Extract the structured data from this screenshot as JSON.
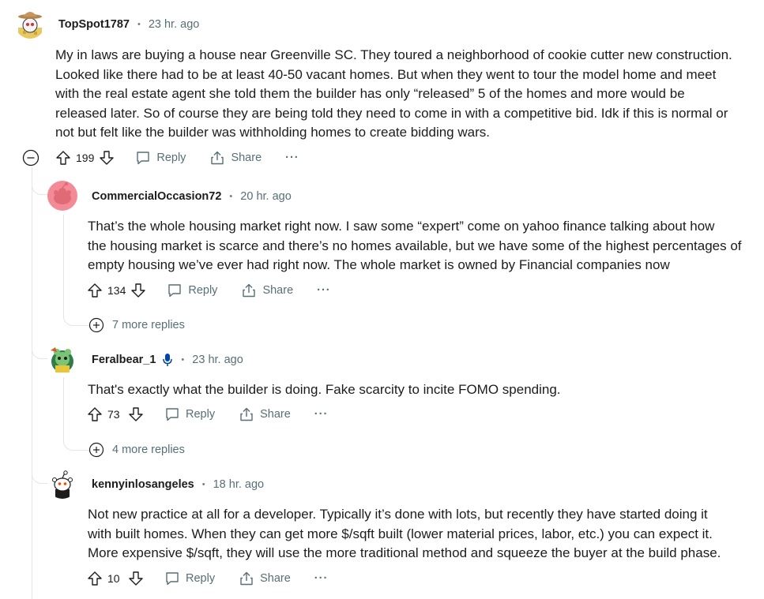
{
  "comments": [
    {
      "username": "TopSpot1787",
      "time": "23 hr. ago",
      "body": [
        "My in laws are buying a house near Greenville SC. They toured a neighborhood of cookie cutter new construction.",
        "Looked like there had to be at least 40-50 vacant homes. But when they went to tour the model home and meet",
        "with the real estate agent she told them the builder has only “released” 5 of the homes and more would be",
        "released later. So of course they are being told they need to come in with a competitive bid. Idk if this is normal or",
        "not but felt like the builder was withholding homes to create bidding wars."
      ],
      "votes": "199",
      "reply_label": "Reply",
      "share_label": "Share",
      "more_label": "···"
    },
    {
      "username": "CommercialOccasion72",
      "time": "20 hr. ago",
      "body": [
        "That’s the whole housing market right now. I saw some “expert” come on yahoo finance talking about how",
        "the housing market is scarce and there’s no homes available, but we have some of the highest percentages of",
        "empty housing we’ve ever had right now. The whole market is owned by Financial companies now"
      ],
      "votes": "134",
      "reply_label": "Reply",
      "share_label": "Share",
      "more_label": "···",
      "more_replies": "7 more replies"
    },
    {
      "username": "Feralbear_1",
      "time": "23 hr. ago",
      "body": [
        "That's exactly what the builder is doing. Fake scarcity to incite FOMO spending."
      ],
      "votes": "73",
      "reply_label": "Reply",
      "share_label": "Share",
      "more_label": "···",
      "more_replies": "4 more replies",
      "flair_icon": "microphone-icon"
    },
    {
      "username": "kennyinlosangeles",
      "time": "18 hr. ago",
      "body": [
        "Not new practice at all for a developer. Typically it’s done with lots, but recently they have started doing it",
        "with built homes. When they can get more $/sqft built (lower material prices, labor, etc.) you can expect it.",
        "More expensive $/sqft, they will use the more traditional method and squeeze the buyer at the build phase."
      ],
      "votes": "10",
      "reply_label": "Reply",
      "share_label": "Share",
      "more_label": "···"
    }
  ],
  "separator": "•",
  "colors": {
    "text": "#1c1c1c",
    "meta": "#576f76",
    "thread_line": "#e5e5e5",
    "avatar_pink": "#f28b95",
    "mic_blue": "#0045ac"
  },
  "icons": [
    "collapse-icon",
    "upvote-icon",
    "downvote-icon",
    "comment-icon",
    "share-icon",
    "expand-icon"
  ]
}
